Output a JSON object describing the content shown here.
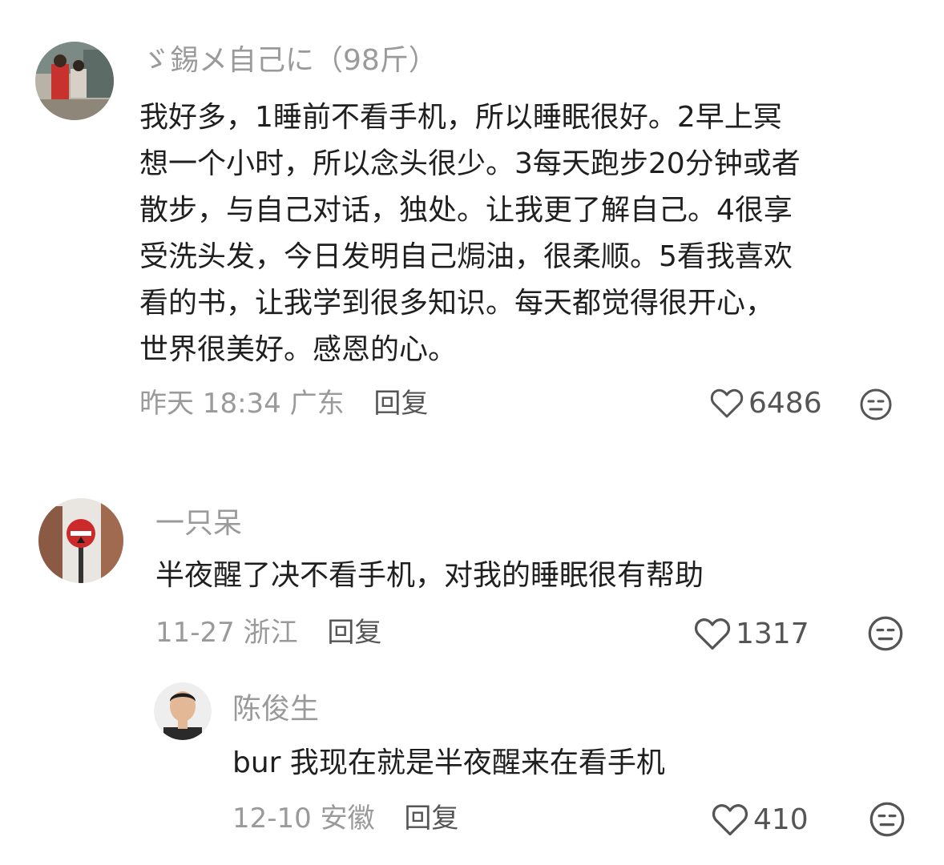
{
  "comments": [
    {
      "username": "ゞ錫メ自己に（98斤）",
      "lines": [
        "我好多，1睡前不看手机，所以睡眠很好。2早上冥",
        "想一个小时，所以念头很少。3每天跑步20分钟或者",
        "散步，与自己对话，独处。让我更了解自己。4很享",
        "受洗头发，今日发明自己焗油，很柔顺。5看我喜欢",
        "看的书，让我学到很多知识。每天都觉得很开心，",
        "世界很美好。感恩的心。"
      ],
      "time": "昨天 18:34",
      "location": "广东",
      "reply_label": "回复",
      "likes": "6486",
      "avatar_icon": "avatar-photo-two-people"
    },
    {
      "username": "一只呆",
      "text": "半夜醒了决不看手机，对我的睡眠很有帮助",
      "time": "11-27",
      "location": "浙江",
      "reply_label": "回复",
      "likes": "1317",
      "avatar_icon": "avatar-photo-street-sign"
    },
    {
      "username": "陈俊生",
      "text": "bur 我现在就是半夜醒来在看手机",
      "time": "12-10",
      "location": "安徽",
      "reply_label": "回复",
      "likes": "410",
      "avatar_icon": "avatar-photo-man-portrait"
    }
  ],
  "colors": {
    "username": "#9a9a9a",
    "body": "#1f1f1f",
    "meta": "#9a9a9a",
    "reply": "#555555",
    "icon": "#555555"
  }
}
